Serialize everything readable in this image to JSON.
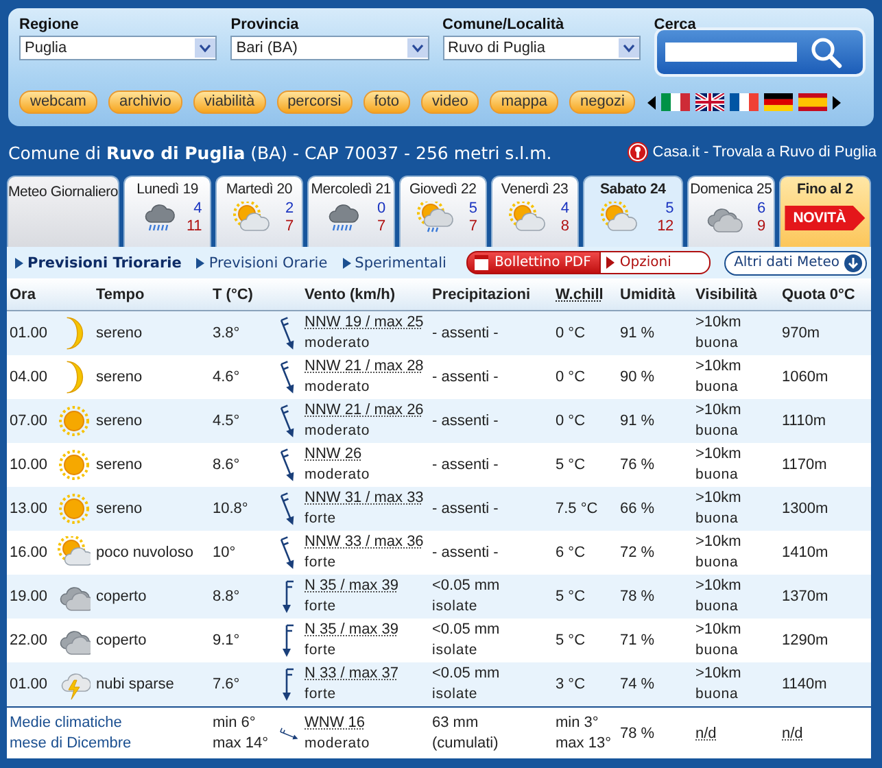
{
  "filters": [
    {
      "label": "Regione",
      "value": "Puglia"
    },
    {
      "label": "Provincia",
      "value": "Bari (BA)"
    },
    {
      "label": "Comune/Località",
      "value": "Ruvo di Puglia"
    }
  ],
  "search": {
    "label": "Cerca"
  },
  "nav_buttons": [
    "webcam",
    "archivio",
    "viabilità",
    "percorsi",
    "foto",
    "video",
    "mappa",
    "negozi"
  ],
  "languages": [
    {
      "kind": "it"
    },
    {
      "kind": "gb"
    },
    {
      "kind": "fr"
    },
    {
      "kind": "de"
    },
    {
      "kind": "es"
    }
  ],
  "location": {
    "title": "Comune di **Ruvo di Puglia** (BA) - CAP 70037 - 256 metri s.l.m.",
    "link": "Casa.it - Trovala a Ruvo di Puglia"
  },
  "tabs": [
    {
      "kind": "daily",
      "label": "Meteo Giornaliero",
      "selected": false
    },
    {
      "kind": "day",
      "label": "Lunedì 19",
      "forecast": {
        "kind": "rain",
        "min": "4",
        "max": "11"
      },
      "selected": false
    },
    {
      "kind": "day",
      "label": "Martedì 20",
      "forecast": {
        "kind": "sun_cloud",
        "min": "2",
        "max": "7"
      },
      "selected": false
    },
    {
      "kind": "day",
      "label": "Mercoledì 21",
      "forecast": {
        "kind": "rain",
        "min": "0",
        "max": "7"
      },
      "selected": false
    },
    {
      "kind": "day",
      "label": "Giovedì 22",
      "forecast": {
        "kind": "sun_rain",
        "min": "5",
        "max": "7"
      },
      "selected": false
    },
    {
      "kind": "day",
      "label": "Venerdì 23",
      "forecast": {
        "kind": "sun_cloud",
        "min": "4",
        "max": "8"
      },
      "selected": false
    },
    {
      "kind": "day",
      "label": "Sabato 24",
      "forecast": {
        "kind": "sun_cloud",
        "min": "5",
        "max": "12"
      },
      "selected": true
    },
    {
      "kind": "day",
      "label": "Domenica 25",
      "forecast": {
        "kind": "cloud",
        "min": "6",
        "max": "9"
      },
      "selected": false
    },
    {
      "kind": "promo",
      "label": "Fino al 2",
      "badge": "NOVITÀ",
      "selected": false
    }
  ],
  "views": [
    {
      "label": "Previsioni Triorarie",
      "selected": true
    },
    {
      "label": "Previsioni Orarie",
      "selected": false
    },
    {
      "label": "Sperimentali",
      "selected": false
    }
  ],
  "pdf_button": "Bollettino PDF",
  "options_button": "Opzioni",
  "more_button": "Altri dati Meteo",
  "table": {
    "columns": [
      "Ora",
      "Tempo",
      "T (°C)",
      "Vento (km/h)",
      "Precipitazioni",
      "W.chill",
      "Umidità",
      "Visibilità",
      "Quota 0°C"
    ],
    "rows": [
      {
        "time": "01.00",
        "sky": {
          "kind": "moon",
          "text": "sereno"
        },
        "temp": "3.8°",
        "wind": {
          "kind": "nnw",
          "text": "NNW 19 / max 25",
          "strength": "moderato"
        },
        "precip": "- assenti -",
        "wchill": "0 °C",
        "humidity": "91 %",
        "visibility": ">10km",
        "visibility_note": "buona",
        "quota": "970m"
      },
      {
        "time": "04.00",
        "sky": {
          "kind": "moon",
          "text": "sereno"
        },
        "temp": "4.6°",
        "wind": {
          "kind": "nnw",
          "text": "NNW 21 / max 28",
          "strength": "moderato"
        },
        "precip": "- assenti -",
        "wchill": "0 °C",
        "humidity": "90 %",
        "visibility": ">10km",
        "visibility_note": "buona",
        "quota": "1060m"
      },
      {
        "time": "07.00",
        "sky": {
          "kind": "sun",
          "text": "sereno"
        },
        "temp": "4.5°",
        "wind": {
          "kind": "nnw",
          "text": "NNW 21 / max 26",
          "strength": "moderato"
        },
        "precip": "- assenti -",
        "wchill": "0 °C",
        "humidity": "91 %",
        "visibility": ">10km",
        "visibility_note": "buona",
        "quota": "1110m"
      },
      {
        "time": "10.00",
        "sky": {
          "kind": "sun",
          "text": "sereno"
        },
        "temp": "8.6°",
        "wind": {
          "kind": "nnw",
          "text": "NNW 26",
          "strength": "moderato"
        },
        "precip": "- assenti -",
        "wchill": "5 °C",
        "humidity": "76 %",
        "visibility": ">10km",
        "visibility_note": "buona",
        "quota": "1170m"
      },
      {
        "time": "13.00",
        "sky": {
          "kind": "sun",
          "text": "sereno"
        },
        "temp": "10.8°",
        "wind": {
          "kind": "nnw",
          "text": "NNW 31 / max 33",
          "strength": "forte"
        },
        "precip": "- assenti -",
        "wchill": "7.5 °C",
        "humidity": "66 %",
        "visibility": ">10km",
        "visibility_note": "buona",
        "quota": "1300m"
      },
      {
        "time": "16.00",
        "sky": {
          "kind": "sun_cloud",
          "text": "poco nuvoloso"
        },
        "temp": "10°",
        "wind": {
          "kind": "nnw",
          "text": "NNW 33 / max 36",
          "strength": "forte"
        },
        "precip": "- assenti -",
        "wchill": "6 °C",
        "humidity": "72 %",
        "visibility": ">10km",
        "visibility_note": "buona",
        "quota": "1410m"
      },
      {
        "time": "19.00",
        "sky": {
          "kind": "cloud",
          "text": "coperto"
        },
        "temp": "8.8°",
        "wind": {
          "kind": "n",
          "text": "N 35 / max 39",
          "strength": "forte"
        },
        "precip": "<0.05 mm",
        "precip_note": "isolate",
        "wchill": "5 °C",
        "humidity": "78 %",
        "visibility": ">10km",
        "visibility_note": "buona",
        "quota": "1370m"
      },
      {
        "time": "22.00",
        "sky": {
          "kind": "cloud",
          "text": "coperto"
        },
        "temp": "9.1°",
        "wind": {
          "kind": "n",
          "text": "N 35 / max 39",
          "strength": "forte"
        },
        "precip": "<0.05 mm",
        "precip_note": "isolate",
        "wchill": "5 °C",
        "humidity": "71 %",
        "visibility": ">10km",
        "visibility_note": "buona",
        "quota": "1290m"
      },
      {
        "time": "01.00",
        "sky": {
          "kind": "storm",
          "text": "nubi sparse"
        },
        "temp": "7.6°",
        "wind": {
          "kind": "n",
          "text": "N 33 / max 37",
          "strength": "forte"
        },
        "precip": "<0.05 mm",
        "precip_note": "isolate",
        "wchill": "3 °C",
        "humidity": "74 %",
        "visibility": ">10km",
        "visibility_note": "buona",
        "quota": "1140m"
      }
    ],
    "footer": {
      "label": "Medie climatiche",
      "label_2": "mese di Dicembre",
      "temp_min": "min 6°",
      "temp_max": "max 14°",
      "wind": {
        "kind": "wnw",
        "text": "WNW 16",
        "strength": "moderato"
      },
      "precip": "63 mm",
      "precip_note": "(cumulati)",
      "wchill_min": "min 3°",
      "wchill_max": "max 13°",
      "humidity": "78 %",
      "visibility": "n/d",
      "quota": "n/d"
    }
  }
}
